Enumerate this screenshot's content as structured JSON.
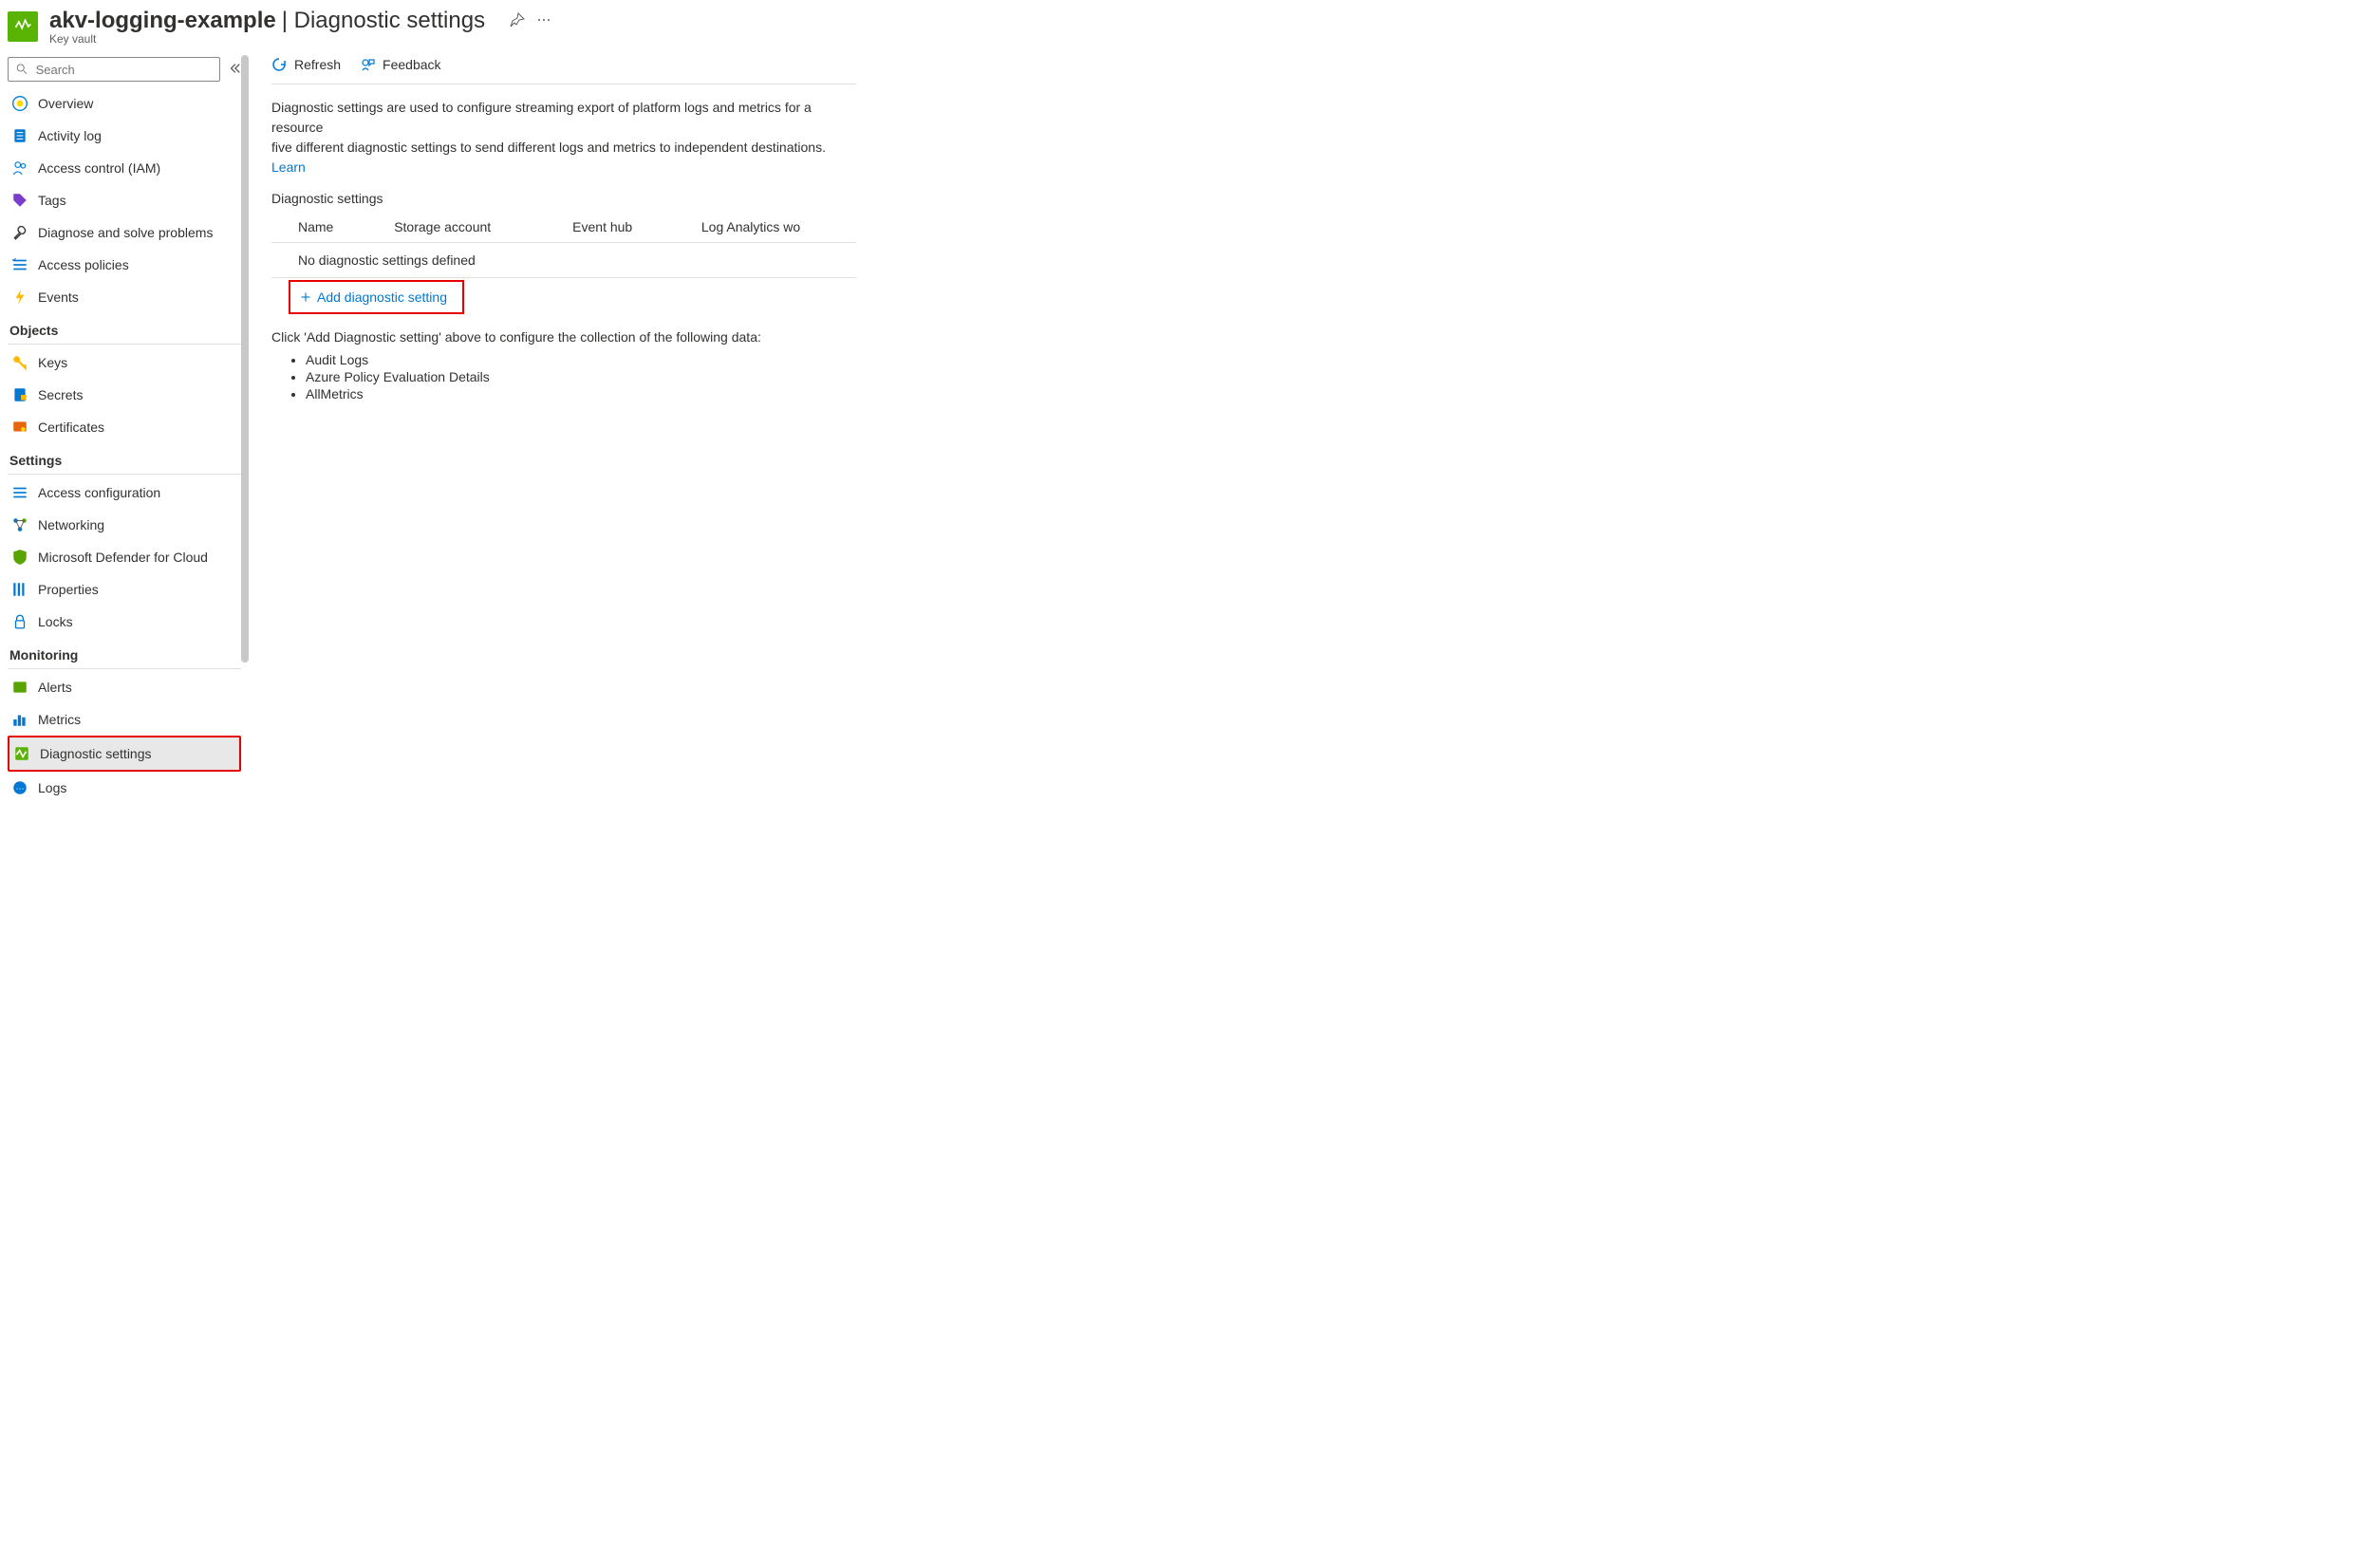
{
  "header": {
    "resource_name": "akv-logging-example",
    "separator": " | ",
    "page_title": "Diagnostic settings",
    "resource_type": "Key vault"
  },
  "sidebar": {
    "search_placeholder": "Search",
    "items_top": [
      {
        "label": "Overview"
      },
      {
        "label": "Activity log"
      },
      {
        "label": "Access control (IAM)"
      },
      {
        "label": "Tags"
      },
      {
        "label": "Diagnose and solve problems"
      },
      {
        "label": "Access policies"
      },
      {
        "label": "Events"
      }
    ],
    "section_objects": "Objects",
    "items_objects": [
      {
        "label": "Keys"
      },
      {
        "label": "Secrets"
      },
      {
        "label": "Certificates"
      }
    ],
    "section_settings": "Settings",
    "items_settings": [
      {
        "label": "Access configuration"
      },
      {
        "label": "Networking"
      },
      {
        "label": "Microsoft Defender for Cloud"
      },
      {
        "label": "Properties"
      },
      {
        "label": "Locks"
      }
    ],
    "section_monitoring": "Monitoring",
    "items_monitoring": [
      {
        "label": "Alerts"
      },
      {
        "label": "Metrics"
      },
      {
        "label": "Diagnostic settings",
        "selected": true
      },
      {
        "label": "Logs"
      }
    ]
  },
  "toolbar": {
    "refresh": "Refresh",
    "feedback": "Feedback"
  },
  "content": {
    "description_1": "Diagnostic settings are used to configure streaming export of platform logs and metrics for a resource",
    "description_2": "five different diagnostic settings to send different logs and metrics to independent destinations. ",
    "learn_more": "Learn ",
    "table_title": "Diagnostic settings",
    "columns": {
      "name": "Name",
      "storage": "Storage account",
      "eventhub": "Event hub",
      "law": "Log Analytics wo"
    },
    "empty_row": "No diagnostic settings defined",
    "add_button": "Add diagnostic setting",
    "lead_text": "Click 'Add Diagnostic setting' above to configure the collection of the following data:",
    "data_types": [
      "Audit Logs",
      "Azure Policy Evaluation Details",
      "AllMetrics"
    ]
  }
}
